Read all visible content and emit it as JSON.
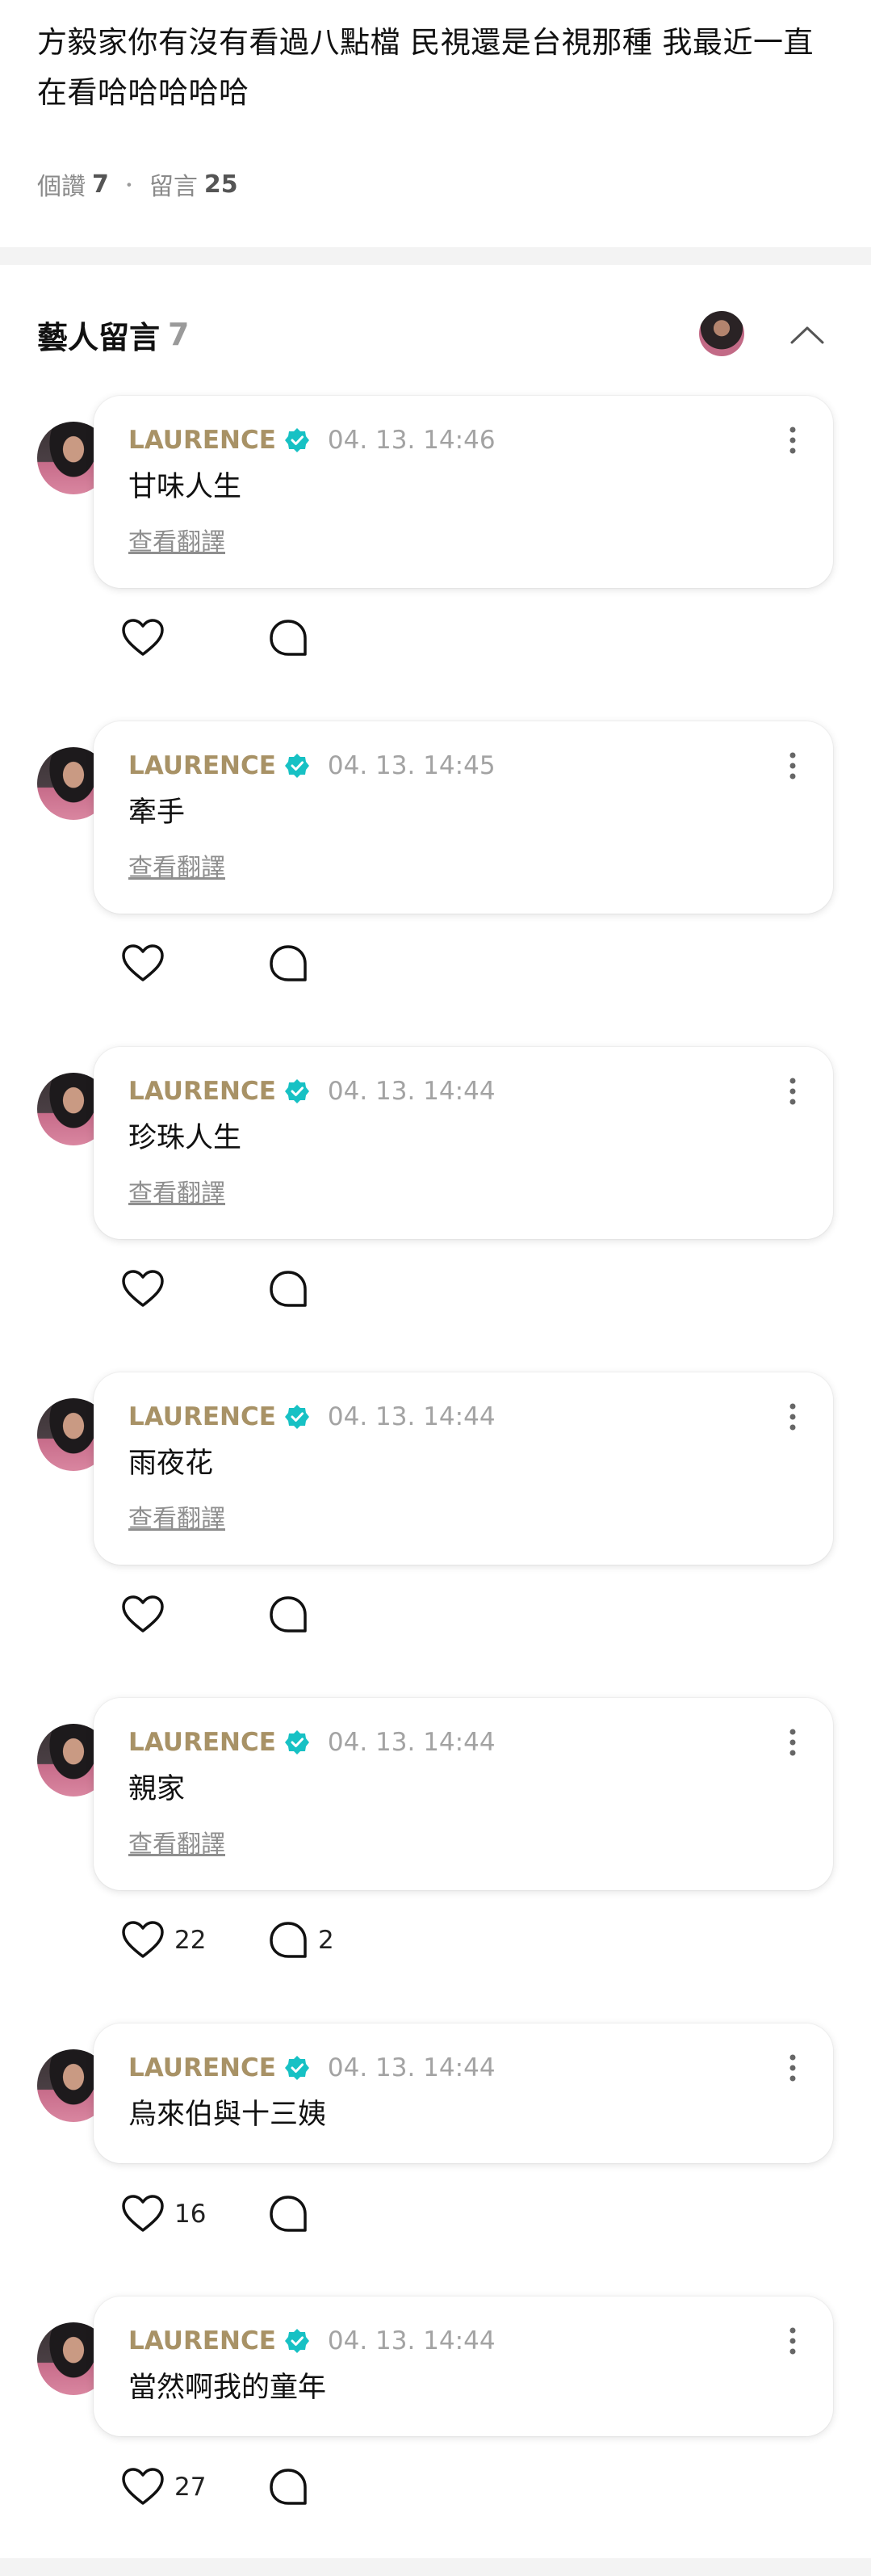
{
  "post": {
    "text": "方毅家你有沒有看過八點檔 民視還是台視那種 我最近一直在看哈哈哈哈哈",
    "likes_label": "個讚",
    "likes_count": "7",
    "separator": "・",
    "comments_label": "留言",
    "comments_count": "25"
  },
  "artist_section": {
    "title": "藝人留言",
    "count": "7",
    "collapse_icon": "chevron-up-icon"
  },
  "colors": {
    "author": "#a89266",
    "verified": "#17c1c4",
    "timestamp": "#a3a3a3",
    "divider": "#f3f3f3"
  },
  "comments": [
    {
      "author": "LAURENCE",
      "time": "04. 13. 14:46",
      "text": "甘味人生",
      "translate": "查看翻譯",
      "likes": "",
      "replies": ""
    },
    {
      "author": "LAURENCE",
      "time": "04. 13. 14:45",
      "text": "牽手",
      "translate": "查看翻譯",
      "likes": "",
      "replies": ""
    },
    {
      "author": "LAURENCE",
      "time": "04. 13. 14:44",
      "text": "珍珠人生",
      "translate": "查看翻譯",
      "likes": "",
      "replies": ""
    },
    {
      "author": "LAURENCE",
      "time": "04. 13. 14:44",
      "text": "雨夜花",
      "translate": "查看翻譯",
      "likes": "",
      "replies": ""
    },
    {
      "author": "LAURENCE",
      "time": "04. 13. 14:44",
      "text": "親家",
      "translate": "查看翻譯",
      "likes": "22",
      "replies": "2"
    },
    {
      "author": "LAURENCE",
      "time": "04. 13. 14:44",
      "text": "烏來伯與十三姨",
      "translate": "",
      "likes": "16",
      "replies": ""
    },
    {
      "author": "LAURENCE",
      "time": "04. 13. 14:44",
      "text": "當然啊我的童年",
      "translate": "",
      "likes": "27",
      "replies": ""
    }
  ]
}
